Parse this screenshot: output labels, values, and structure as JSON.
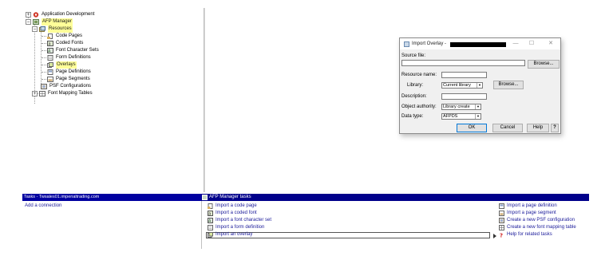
{
  "tree": {
    "items": [
      {
        "label": "Application Development",
        "expander": "+"
      },
      {
        "label": "AFP Manager",
        "expander": "−"
      },
      {
        "label": "Resources",
        "expander": "−"
      },
      {
        "label": "Code Pages"
      },
      {
        "label": "Coded Fonts"
      },
      {
        "label": "Font Character Sets"
      },
      {
        "label": "Form Definitions"
      },
      {
        "label": "Overlays"
      },
      {
        "label": "Page Definitions"
      },
      {
        "label": "Page Segments"
      },
      {
        "label": "PSF Configurations"
      },
      {
        "label": "Font Mapping Tables",
        "expander": "+"
      }
    ]
  },
  "left_panel": {
    "title": "Tasks - Twsales01.imperialtrading.com",
    "links": [
      {
        "label": "Add a connection"
      }
    ]
  },
  "right_panel": {
    "title": "AFP Manager tasks",
    "links_left": [
      {
        "label": "Import a code page"
      },
      {
        "label": "Import a coded font"
      },
      {
        "label": "Import a font character set"
      },
      {
        "label": "Import a form definition"
      },
      {
        "label": "Import an overlay"
      }
    ],
    "links_right": [
      {
        "label": "Import a page definition"
      },
      {
        "label": "Import a page segment"
      },
      {
        "label": "Create a new PSF configuration"
      },
      {
        "label": "Create a new font mapping table"
      },
      {
        "label": "Help for related tasks"
      }
    ]
  },
  "dialog": {
    "title": "Import Overlay -",
    "minimize": "—",
    "maximize": "☐",
    "close": "✕",
    "source_file_label": "Source file:",
    "source_file_value": "",
    "browse1": "Browse...",
    "resource_name_label": "Resource name:",
    "resource_name_value": "",
    "library_label": "Library:",
    "library_value": "Current library",
    "browse2": "Browse...",
    "description_label": "Description:",
    "description_value": "",
    "object_authority_label": "Object authority:",
    "object_authority_value": "Library create",
    "data_type_label": "Data type:",
    "data_type_value": "AFPDS",
    "ok": "OK",
    "cancel": "Cancel",
    "help": "Help",
    "whats_this": "?"
  },
  "colors": {
    "highlight": "#ffff99",
    "task_bar": "#00008b",
    "link": "#1a1a9a"
  }
}
